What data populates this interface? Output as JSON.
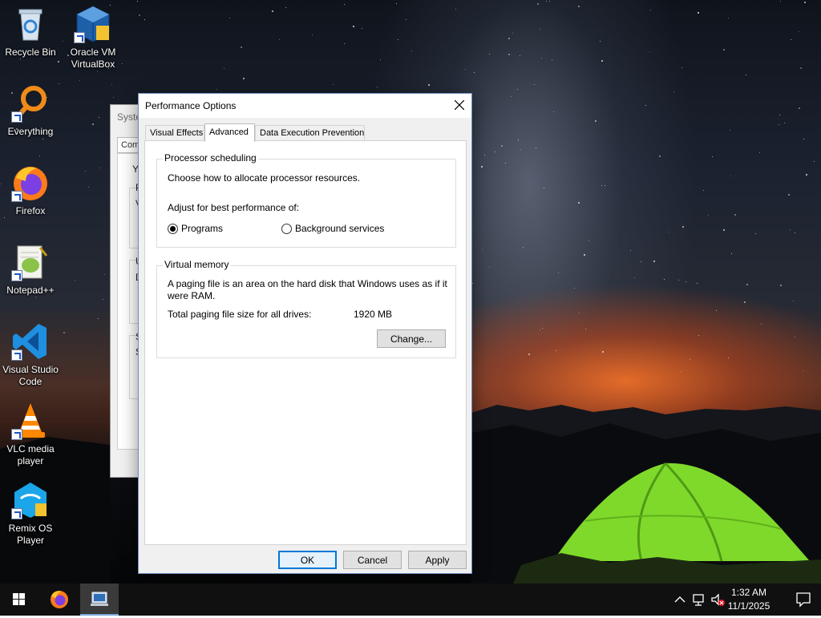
{
  "desktop": {
    "icons": [
      {
        "label": "Recycle Bin",
        "icon": "recycle-bin-icon"
      },
      {
        "label": "Oracle VM VirtualBox",
        "icon": "virtualbox-icon"
      },
      {
        "label": "Everything",
        "icon": "everything-search-icon"
      },
      {
        "label": "Firefox",
        "icon": "firefox-icon"
      },
      {
        "label": "Notepad++",
        "icon": "notepad-plus-plus-icon"
      },
      {
        "label": "Visual Studio Code",
        "icon": "vscode-icon"
      },
      {
        "label": "VLC media player",
        "icon": "vlc-icon"
      },
      {
        "label": "Remix OS Player",
        "icon": "remix-os-icon"
      }
    ]
  },
  "background_window": {
    "title_fragment": "Syste",
    "tab_fragment": "Com",
    "fragments": [
      "Yo",
      "P",
      "V",
      "U",
      "D",
      "S",
      "S"
    ]
  },
  "dialog": {
    "title": "Performance Options",
    "tabs": [
      {
        "label": "Visual Effects",
        "active": false
      },
      {
        "label": "Advanced",
        "active": true
      },
      {
        "label": "Data Execution Prevention",
        "active": false
      }
    ],
    "processor": {
      "group_title": "Processor scheduling",
      "description": "Choose how to allocate processor resources.",
      "adjust_label": "Adjust for best performance of:",
      "options": [
        {
          "label": "Programs",
          "selected": true
        },
        {
          "label": "Background services",
          "selected": false
        }
      ]
    },
    "virtual_memory": {
      "group_title": "Virtual memory",
      "description": "A paging file is an area on the hard disk that Windows uses as if it were RAM.",
      "total_label": "Total paging file size for all drives:",
      "total_value": "1920 MB",
      "change_button": "Change..."
    },
    "buttons": {
      "ok": "OK",
      "cancel": "Cancel",
      "apply": "Apply"
    }
  },
  "taskbar": {
    "pinned": [
      "start-icon",
      "firefox-icon",
      "system-properties-icon"
    ],
    "clock": {
      "time": "1:32 AM",
      "date": "11/1/2025"
    }
  },
  "colors": {
    "accent": "#0078d7",
    "taskbar": "#101010",
    "dialog_bg": "#f0f0f0"
  }
}
